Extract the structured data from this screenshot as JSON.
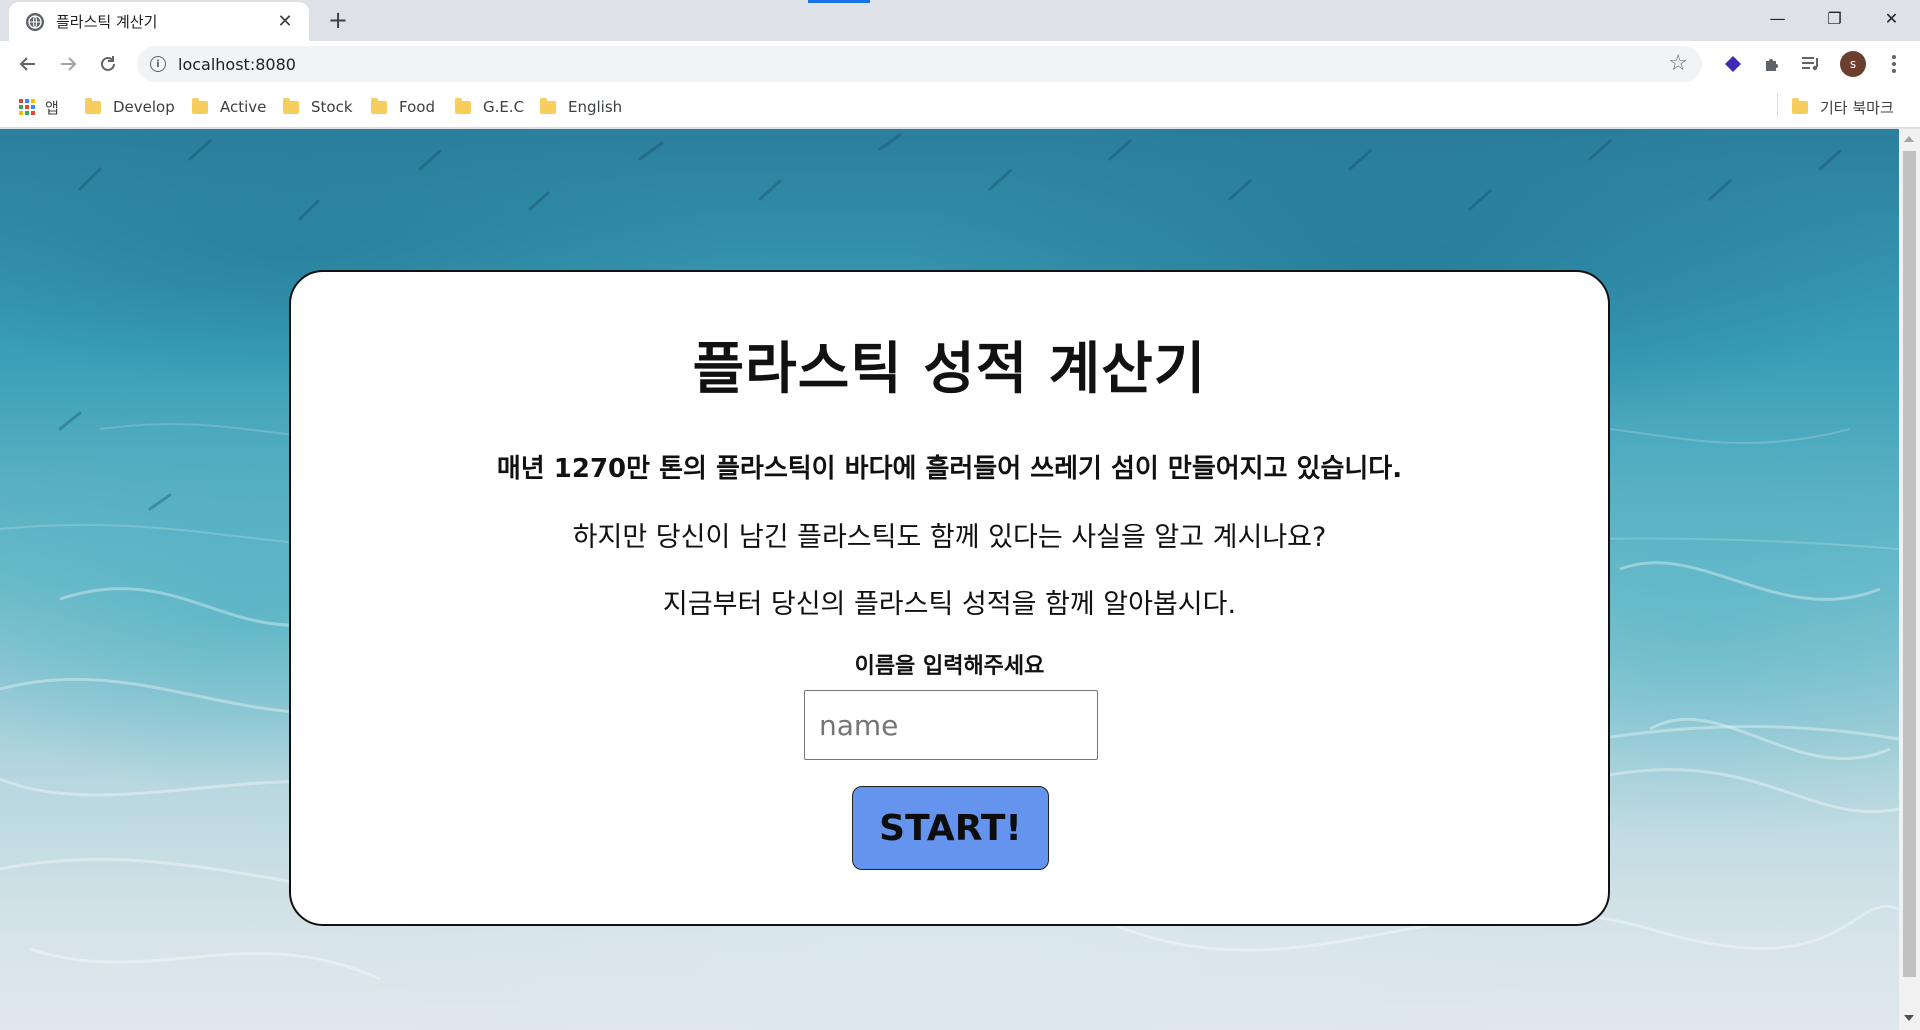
{
  "browser": {
    "tab": {
      "title": "플라스틱 계산기",
      "icon": "globe-icon",
      "close_icon": "close-icon"
    },
    "new_tab_label": "+",
    "window_controls": {
      "minimize": "—",
      "restore": "❐",
      "close": "✕"
    },
    "address": {
      "url": "localhost:8080",
      "info_icon": "i"
    },
    "avatar_letter": "s",
    "bookmarks": {
      "apps_label": "앱",
      "items": [
        {
          "label": "Develop"
        },
        {
          "label": "Active"
        },
        {
          "label": "Stock"
        },
        {
          "label": "Food"
        },
        {
          "label": "G.E.C"
        },
        {
          "label": "English"
        }
      ],
      "other_label": "기타 북마크"
    }
  },
  "page": {
    "title": "플라스틱 성적 계산기",
    "line1": "매년 1270만 톤의 플라스틱이 바다에 흘러들어 쓰레기 섬이 만들어지고 있습니다.",
    "line2": "하지만 당신이 남긴 플라스틱도 함께 있다는 사실을 알고 계시나요?",
    "line3": "지금부터 당신의 플라스틱 성적을 함께 알아봅시다.",
    "name_label": "이름을 입력해주세요",
    "name_placeholder": "name",
    "name_value": "",
    "start_label": "START!"
  },
  "colors": {
    "accent_button": "#6494ed",
    "tab_indicator": "#1a73e8",
    "folder": "#f7cd5d"
  }
}
